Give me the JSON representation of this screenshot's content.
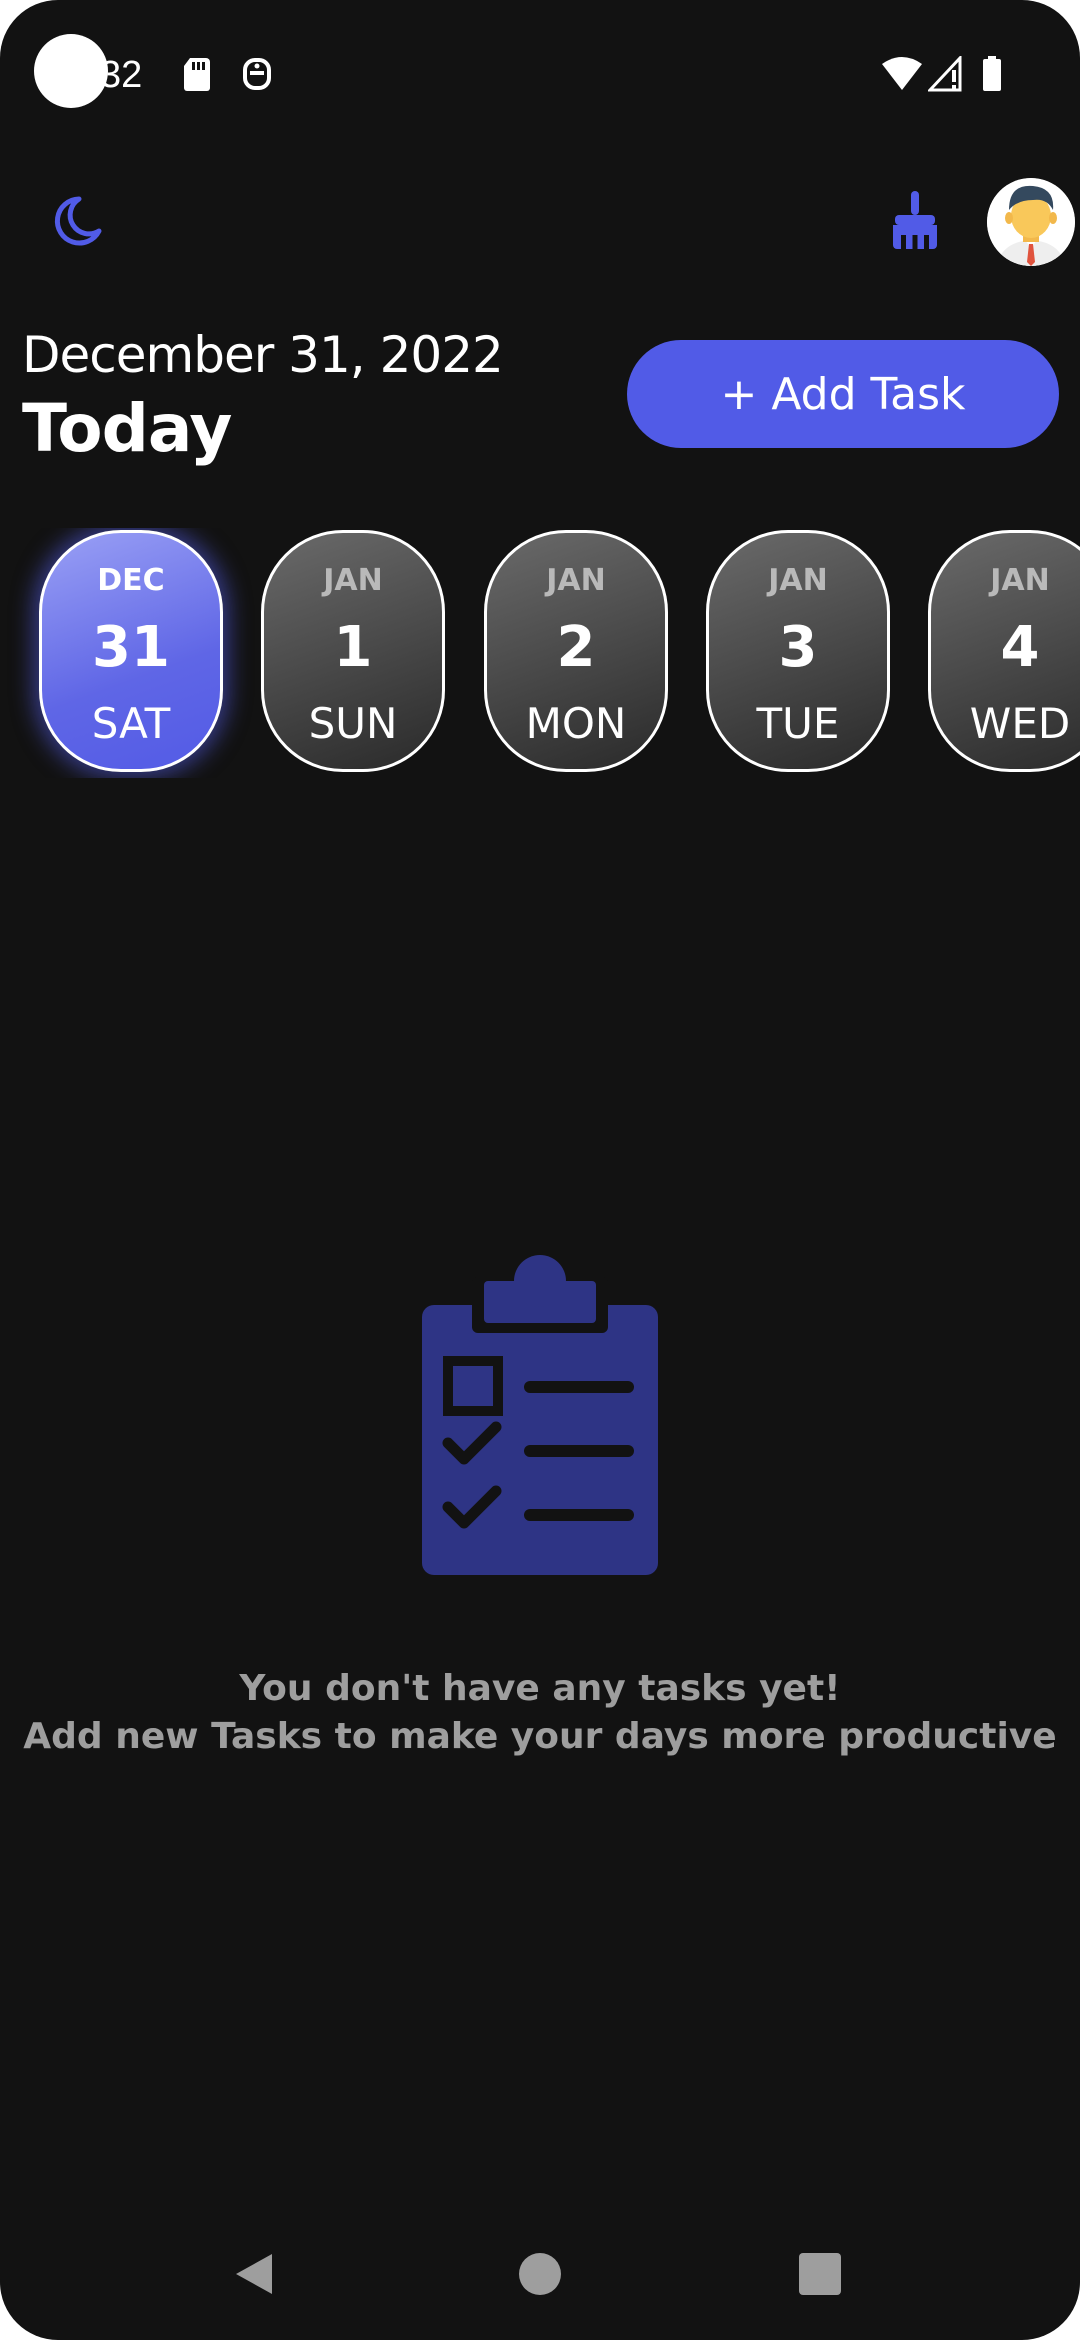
{
  "status_bar": {
    "time": "32",
    "icons": [
      "sd-card-icon",
      "accessibility-icon",
      "wifi-icon",
      "signal-icon",
      "battery-icon"
    ]
  },
  "header": {
    "theme_icon": "moon-icon",
    "clear_icon": "broom-icon",
    "avatar": "user-avatar"
  },
  "date_heading": {
    "date": "December 31, 2022",
    "label": "Today"
  },
  "add_task": {
    "label": "+ Add Task"
  },
  "date_strip": [
    {
      "month": "DEC",
      "day": "31",
      "weekday": "SAT",
      "selected": true
    },
    {
      "month": "JAN",
      "day": "1",
      "weekday": "SUN",
      "selected": false
    },
    {
      "month": "JAN",
      "day": "2",
      "weekday": "MON",
      "selected": false
    },
    {
      "month": "JAN",
      "day": "3",
      "weekday": "TUE",
      "selected": false
    },
    {
      "month": "JAN",
      "day": "4",
      "weekday": "WED",
      "selected": false
    }
  ],
  "empty_state": {
    "icon": "clipboard-checklist-icon",
    "line1": "You don't have any tasks yet!",
    "line2": "Add new Tasks to make your days more productive"
  },
  "nav_bar": {
    "back": "back-icon",
    "home": "home-icon",
    "recents": "recents-icon"
  },
  "colors": {
    "background": "#121212",
    "accent": "#515BE7",
    "muted_text": "#9E9E9E",
    "illustration": "#2E3485"
  }
}
